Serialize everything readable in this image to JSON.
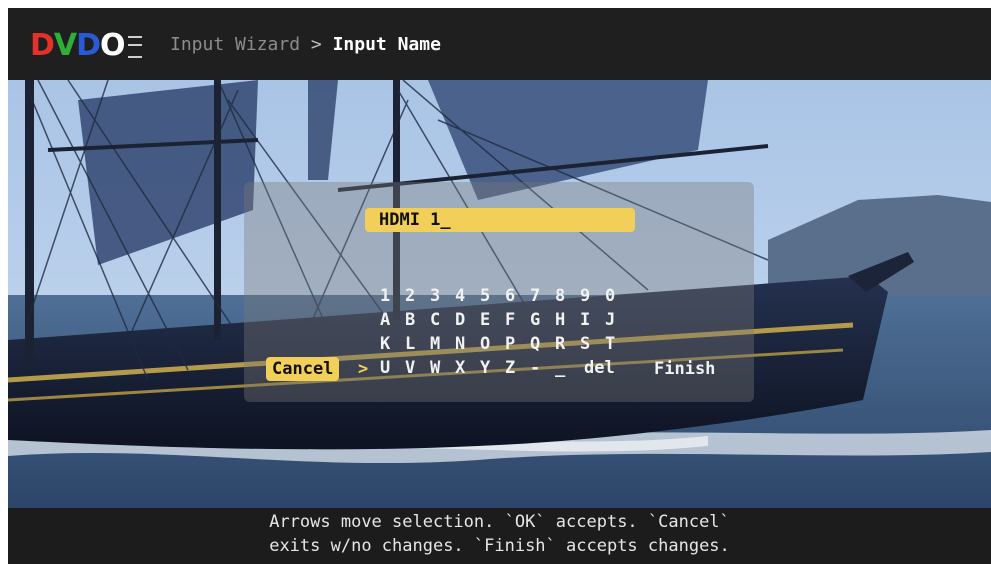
{
  "header": {
    "logo": {
      "letters": [
        "D",
        "V",
        "D",
        "O"
      ],
      "colors": [
        "#e3322b",
        "#2fae3a",
        "#2a5bd7",
        "#ffffff"
      ]
    },
    "breadcrumb": {
      "parent": "Input Wizard",
      "separator": ">",
      "current": "Input Name"
    }
  },
  "editor": {
    "name_value": "HDMI 1_",
    "keyboard_rows": [
      [
        "1",
        "2",
        "3",
        "4",
        "5",
        "6",
        "7",
        "8",
        "9",
        "0"
      ],
      [
        "A",
        "B",
        "C",
        "D",
        "E",
        "F",
        "G",
        "H",
        "I",
        "J"
      ],
      [
        "K",
        "L",
        "M",
        "N",
        "O",
        "P",
        "Q",
        "R",
        "S",
        "T"
      ],
      [
        "U",
        "V",
        "W",
        "X",
        "Y",
        "Z",
        "-",
        "_",
        "del"
      ]
    ],
    "cancel_label": "Cancel",
    "selection_marker": ">",
    "finish_label": "Finish",
    "highlight_color": "#f2cf59"
  },
  "footer": {
    "line1": "Arrows move selection. `OK` accepts. `Cancel`",
    "line2": "exits w/no changes. `Finish` accepts changes."
  }
}
